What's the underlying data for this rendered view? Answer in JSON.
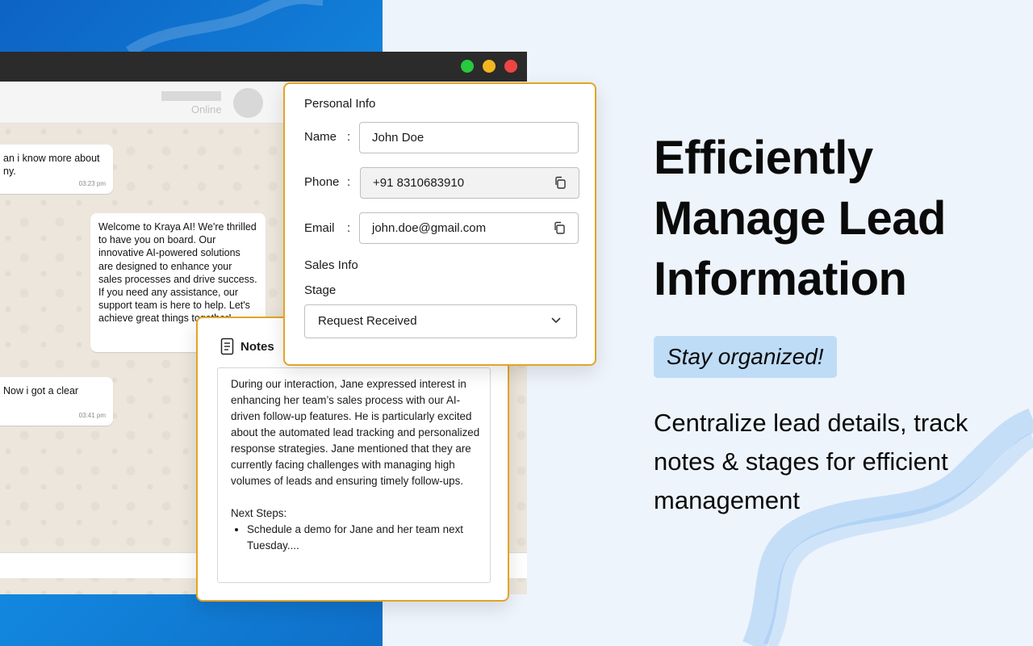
{
  "colors": {
    "accent_border": "#e3a424",
    "left_bg": "#1389e0",
    "right_bg": "#eef4fc",
    "tag_bg": "#bfdcf6",
    "window_dots": [
      "#27c93f",
      "#f4b51f",
      "#ef4444"
    ]
  },
  "chat": {
    "status": "Online",
    "messages": [
      {
        "text": "an i know more about ny.",
        "time": "03:23 pm"
      },
      {
        "text": "Welcome to Kraya AI! We're thrilled to have you on board. Our innovative AI-powered solutions are designed to enhance your sales processes and drive success. If you need any assistance, our support team is here to help. Let's achieve great things together!"
      },
      {
        "text": "Now i got a clear",
        "time": "03:41 pm"
      }
    ]
  },
  "personal_info": {
    "title": "Personal Info",
    "name_label": "Name",
    "name_value": "John Doe",
    "phone_label": "Phone",
    "phone_value": "+91 8310683910",
    "email_label": "Email",
    "email_value": "john.doe@gmail.com",
    "colon": ":",
    "copy_icon": "copy-icon"
  },
  "sales_info": {
    "title": "Sales Info",
    "stage_label": "Stage",
    "stage_value": "Request Received"
  },
  "notes": {
    "title": "Notes",
    "paragraph": "During our interaction, Jane expressed interest in enhancing her team’s sales process with our AI-driven follow-up features. He is particularly excited about the automated lead tracking and personalized response strategies. Jane mentioned that they are currently facing challenges with managing high volumes of leads and ensuring timely follow-ups.",
    "next_steps_label": "Next Steps:",
    "next_steps": [
      "Schedule a demo for Jane and her team next Tuesday...."
    ]
  },
  "hero": {
    "headline": "Efficiently Manage Lead Information",
    "tag": "Stay organized!",
    "description": "Centralize lead details, track notes & stages for efficient management"
  }
}
